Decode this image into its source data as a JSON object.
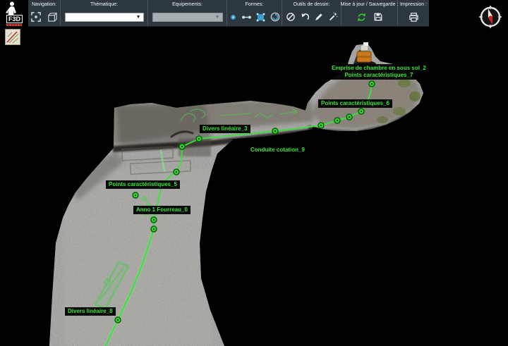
{
  "logo": {
    "text": "F3D"
  },
  "toolbar": {
    "sections": {
      "navigation": {
        "label": "Navigation:",
        "icons": [
          "pan-extent-icon",
          "cube-3d-icon"
        ]
      },
      "thematique": {
        "label": "Thématique:",
        "select_value": ""
      },
      "equipements": {
        "label": "Equipements:",
        "select_value": ""
      },
      "formes": {
        "label": "Formes:",
        "icons": [
          "point-tool-icon",
          "segment-tool-icon",
          "polygon-tool-icon",
          "circle-tool-icon"
        ]
      },
      "outils": {
        "label": "Outils de dessin:",
        "icons": [
          "no-draw-icon",
          "undo-icon",
          "pencil-icon",
          "magic-wand-icon"
        ]
      },
      "sauvegarde": {
        "label": "Mise à jour / Sauvegarde :",
        "icons": [
          "refresh-icon",
          "save-icon"
        ]
      },
      "impression": {
        "label": "Impression :",
        "icons": [
          "printer-icon"
        ]
      }
    }
  },
  "map": {
    "annotation_color": "#3be23b",
    "labels": [
      {
        "lines": [
          "Emprise de chambre en sous sol_2",
          "Points caractéristiques_7"
        ]
      },
      {
        "text": "Points caractéristiques_6"
      },
      {
        "text": "Divers linéaire_3"
      },
      {
        "text": "Conduite cotation_9"
      },
      {
        "text": "Points caractéristiques_5"
      },
      {
        "text": "Anno 1 Fourreau_0"
      },
      {
        "text": "Divers linéaire_8"
      }
    ]
  }
}
